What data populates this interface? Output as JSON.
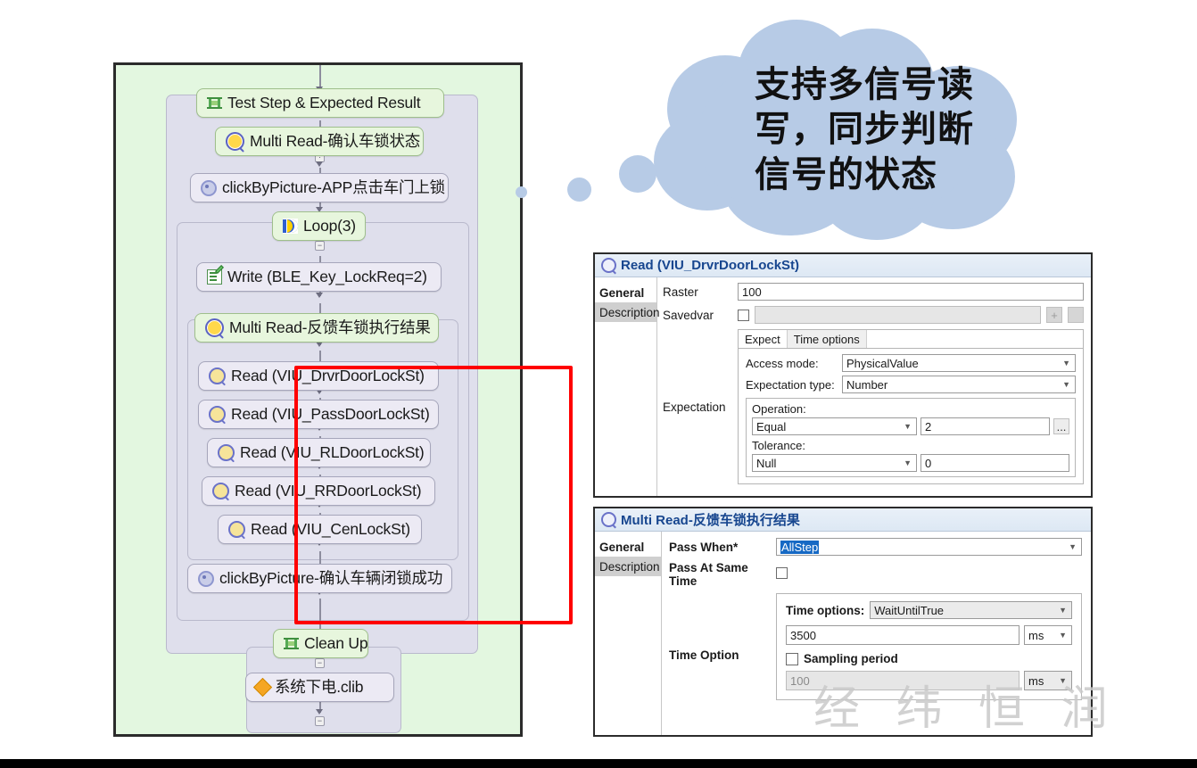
{
  "flowchart": {
    "nodes": [
      {
        "id": "test-step",
        "label": "Test Step & Expected Result",
        "icon": "testcase-icon"
      },
      {
        "id": "multi-read-confirm",
        "label": "Multi Read-确认车锁状态",
        "icon": "magnifier-icon"
      },
      {
        "id": "click-lock",
        "label": "clickByPicture-APP点击车门上锁",
        "icon": "gear-icon"
      },
      {
        "id": "loop",
        "label": "Loop(3)",
        "icon": "loop-icon"
      },
      {
        "id": "write",
        "label": "Write (BLE_Key_LockReq=2)",
        "icon": "write-icon"
      },
      {
        "id": "multi-read-feedback",
        "label": "Multi Read-反馈车锁执行结果",
        "icon": "magnifier-icon"
      },
      {
        "id": "read-drvr",
        "label": "Read (VIU_DrvrDoorLockSt)",
        "icon": "magnifier-icon"
      },
      {
        "id": "read-pass",
        "label": "Read (VIU_PassDoorLockSt)",
        "icon": "magnifier-icon"
      },
      {
        "id": "read-rl",
        "label": "Read (VIU_RLDoorLockSt)",
        "icon": "magnifier-icon"
      },
      {
        "id": "read-rr",
        "label": "Read (VIU_RRDoorLockSt)",
        "icon": "magnifier-icon"
      },
      {
        "id": "read-cen",
        "label": "Read (VIU_CenLockSt)",
        "icon": "magnifier-icon"
      },
      {
        "id": "click-confirm",
        "label": "clickByPicture-确认车辆闭锁成功",
        "icon": "gear-icon"
      },
      {
        "id": "clean-up",
        "label": "Clean Up",
        "icon": "testcase-icon"
      },
      {
        "id": "power-off",
        "label": "系统下电.clib",
        "icon": "diamond-icon"
      }
    ],
    "highlight_color": "#ff0000",
    "panel_background": "#e3f7e0"
  },
  "callout": {
    "text_lines": [
      "支持多信号读",
      "写，同步判断",
      "信号的状态"
    ],
    "bubble_color": "#b7cbe6"
  },
  "read_dialog": {
    "title": "Read (VIU_DrvrDoorLockSt)",
    "tabs": [
      "General",
      "Description"
    ],
    "raster_label": "Raster",
    "raster_value": "100",
    "savedvar_label": "Savedvar",
    "savedvar_checked": false,
    "savedvar_value": "",
    "add_button": "+",
    "remove_button": "−",
    "inner_tabs": [
      "Expect",
      "Time options"
    ],
    "access_mode_label": "Access mode:",
    "access_mode_value": "PhysicalValue",
    "expectation_type_label": "Expectation type:",
    "expectation_type_value": "Number",
    "expectation_label": "Expectation",
    "operation_label": "Operation:",
    "operation_value": "Equal",
    "operation_operand": "2",
    "browse_button": "...",
    "tolerance_label": "Tolerance:",
    "tolerance_value": "Null",
    "tolerance_operand": "0"
  },
  "multi_read_dialog": {
    "title": "Multi Read-反馈车锁执行结果",
    "tabs": [
      "General",
      "Description"
    ],
    "pass_when_label": "Pass When*",
    "pass_when_value": "AllStep",
    "pass_at_same_time_label": "Pass At Same Time",
    "pass_at_same_time_checked": false,
    "time_option_label": "Time Option",
    "time_options_label": "Time options:",
    "time_options_value": "WaitUntilTrue",
    "timeout_value": "3500",
    "timeout_unit": "ms",
    "sampling_period_label": "Sampling period",
    "sampling_period_checked": false,
    "sampling_value": "100",
    "sampling_unit": "ms"
  },
  "watermark": {
    "text": "经 纬 恒 润"
  }
}
